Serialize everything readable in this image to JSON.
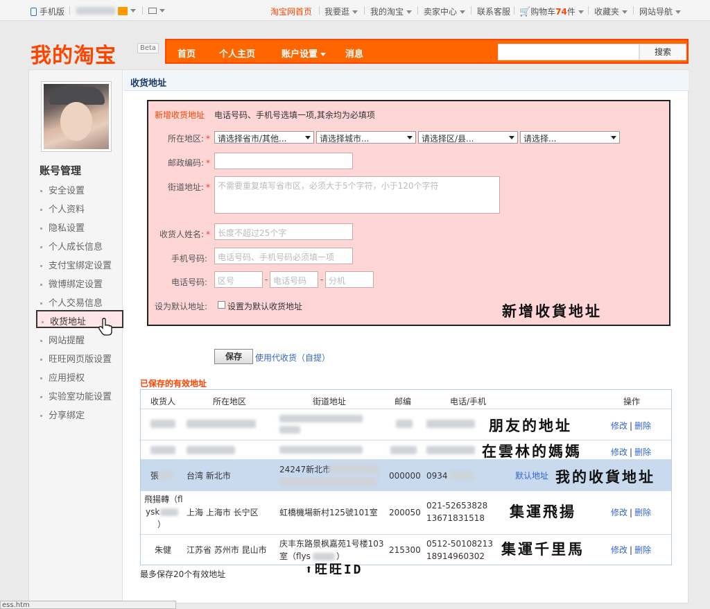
{
  "topbar": {
    "mobile": "手机版",
    "taobao_home": "淘宝网首页",
    "shop": "我要逛",
    "my_taobao": "我的淘宝",
    "seller": "卖家中心",
    "service": "联系客服",
    "cart_prefix": "购物车",
    "cart_count": "74",
    "cart_suffix": "件",
    "favorites": "收藏夹",
    "sitemap": "网站导航"
  },
  "header": {
    "logo": "我的淘宝",
    "beta": "Beta",
    "nav": [
      "首页",
      "个人主页",
      "账户设置",
      "消息"
    ],
    "search_button": "搜索"
  },
  "sidebar": {
    "title": "账号管理",
    "items": [
      "安全设置",
      "个人资料",
      "隐私设置",
      "个人成长信息",
      "支付宝绑定设置",
      "微博绑定设置",
      "个人交易信息",
      "收货地址",
      "网站提醒",
      "旺旺网页版设置",
      "应用授权",
      "实验室功能设置",
      "分享绑定"
    ],
    "active_index": 7
  },
  "content": {
    "title": "收货地址",
    "form": {
      "heading": "新增收货地址",
      "hint": "电话号码、手机号选填一项,其余均为必填项",
      "region_label": "所在地区:",
      "region_selects": [
        "请选择省市/其他...",
        "请选择城市...",
        "请选择区/县...",
        "请选择..."
      ],
      "zip_label": "邮政编码:",
      "street_label": "街道地址:",
      "street_placeholder": "不需要重复填写省市区，必须大于5个字符，小于120个字符",
      "name_label": "收货人姓名:",
      "name_placeholder": "长度不超过25个字",
      "mobile_label": "手机号码:",
      "mobile_placeholder": "电话号码、手机号码必须填一项",
      "phone_label": "电话号码:",
      "phone_area": "区号",
      "phone_number": "电话号码",
      "phone_ext": "分机",
      "default_label": "设为默认地址:",
      "default_checkbox": "设置为默认收货地址",
      "note": "新增收貨地址"
    },
    "save_button": "保存",
    "pickup_link": "使用代收货（自提）",
    "saved_title": "已保存的有效地址",
    "table": {
      "headers": [
        "收货人",
        "所在地区",
        "街道地址",
        "邮编",
        "电话/手机",
        "操作"
      ],
      "rows": [
        {
          "name": "",
          "region": "",
          "street": "",
          "zip": "",
          "phone": "",
          "note": "朋友的地址",
          "edit": "修改",
          "delete": "删除"
        },
        {
          "name": "",
          "region": "",
          "street": "",
          "zip": "",
          "phone": "",
          "note": "在雲林的媽媽",
          "edit": "修改",
          "delete": "删除"
        },
        {
          "name": "張",
          "region": "台湾 新北市",
          "street": "24247新北市",
          "zip": "000000",
          "phone": "0934",
          "default": "默认地址",
          "note": "我的收貨地址",
          "edit": "修改",
          "delete": "删除"
        },
        {
          "name_l1": "飛揚轉（fl",
          "name_l2": "ysk",
          "name_l3": "）",
          "region": "上海 上海市 长宁区",
          "street": "虹橋機場新村125號101室",
          "zip": "200050",
          "phone_l1": "021-52653828",
          "phone_l2": "13671831518",
          "note": "集運飛揚",
          "edit": "修改",
          "delete": "删除"
        },
        {
          "name": "朱健",
          "region": "江苏省 苏州市 昆山市",
          "street_l1": "庆丰东路景枫嘉苑1号楼103",
          "street_l2": "室（flys",
          "street_l3": "）",
          "zip": "215300",
          "phone_l1": "0512-50108213",
          "phone_l2": "18914960302",
          "note": "集運千里馬",
          "edit": "修改",
          "delete": "删除"
        }
      ]
    },
    "wangwang_note": "旺旺ID",
    "footer": "最多保存20个有效地址"
  },
  "statusbar": "ess.htm",
  "colors": {
    "brand_orange": "#ff6600",
    "link_blue": "#3366cc",
    "form_pink": "#ffd6d6",
    "row_highlight": "#c9d9ee"
  }
}
